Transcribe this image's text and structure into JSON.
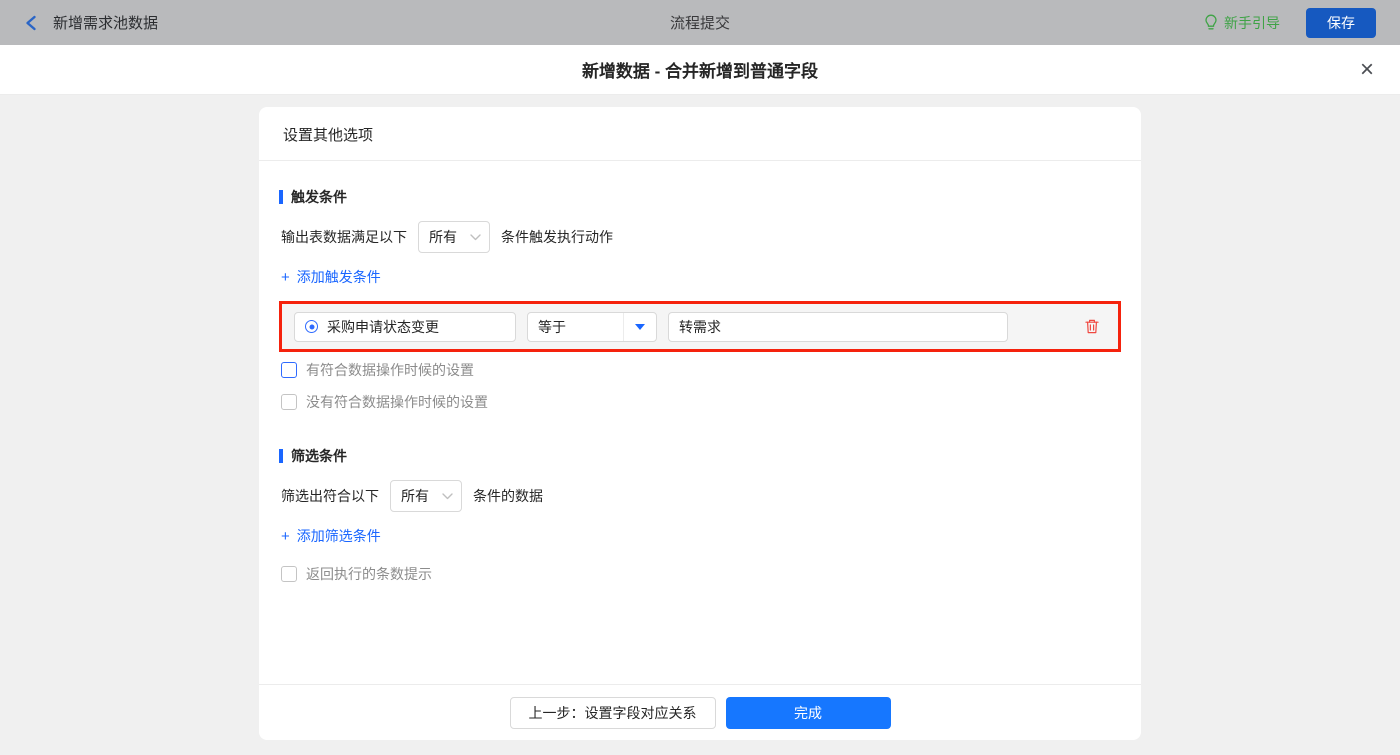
{
  "colors": {
    "accent_blue": "#1a66ff",
    "done_button_blue": "#1677ff",
    "save_button_blue": "#1659c0",
    "guide_green": "#3fa346",
    "highlight_red": "#f5220d",
    "trash_red": "#f04840",
    "topbar_gray": "#b9babc"
  },
  "topbar": {
    "back_icon": "chevron-left-icon",
    "back_label": "新增需求池数据",
    "title": "流程提交",
    "guide_icon": "lightbulb-icon",
    "guide_label": "新手引导",
    "save_button": "保存"
  },
  "dialog": {
    "title": "新增数据 - 合并新增到普通字段",
    "close_glyph": "×"
  },
  "panel": {
    "header": "设置其他选项",
    "trigger": {
      "section_title": "触发条件",
      "prefix": "输出表数据满足以下",
      "match_select": "所有",
      "suffix": "条件触发执行动作",
      "plus": "+",
      "add_label": "添加触发条件",
      "row": {
        "field_icon": "radio-selected-icon",
        "field": "采购申请状态变更",
        "operator": "等于",
        "value": "转需求",
        "delete_icon": "trash-icon"
      },
      "checkbox_match": "有符合数据操作时候的设置",
      "checkbox_no_match": "没有符合数据操作时候的设置"
    },
    "filter": {
      "section_title": "筛选条件",
      "prefix": "筛选出符合以下",
      "match_select": "所有",
      "suffix": "条件的数据",
      "plus": "+",
      "add_label": "添加筛选条件",
      "checkbox_count": "返回执行的条数提示"
    },
    "footer": {
      "prev_button": "上一步：设置字段对应关系",
      "done_button": "完成"
    }
  }
}
